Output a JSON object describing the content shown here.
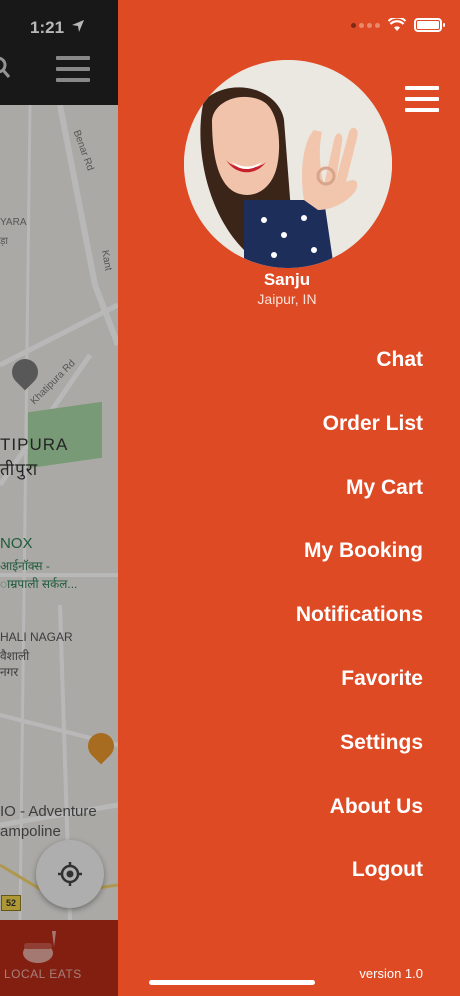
{
  "status_bar": {
    "time": "1:21"
  },
  "background": {
    "map_labels": {
      "benar_rd": "Benar Rd",
      "yara": "YARA",
      "yara_hi": "ड़ा",
      "kant": "Kant",
      "khatipura_rd": "Khatipura Rd",
      "khatipura": "TIPURA",
      "khatipura_hi": "तीपुरा",
      "inox": "NOX",
      "inox_hi": "आईनॉक्स -",
      "amrapali_hi": "ाम्रपाली सर्कल...",
      "vaishali": "HALI NAGAR",
      "vaishali_hi1": "वैशाली",
      "vaishali_hi2": "नगर",
      "adventure1": "IO - Adventure",
      "adventure2": "ampoline",
      "road_badge": "52"
    },
    "tabbar": {
      "label": "LOCAL EATS"
    }
  },
  "drawer": {
    "profile": {
      "name": "Sanju",
      "location": "Jaipur, IN"
    },
    "menu": [
      "Chat",
      "Order List",
      "My Cart",
      "My Booking",
      "Notifications",
      "Favorite",
      "Settings",
      "About Us",
      "Logout"
    ],
    "version": "version 1.0",
    "accent_color": "#de4a24"
  }
}
